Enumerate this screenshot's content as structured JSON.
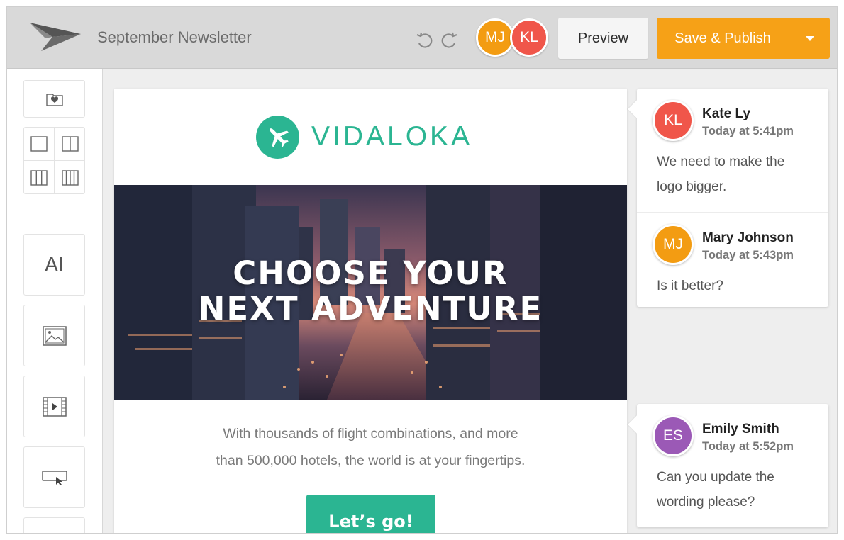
{
  "header": {
    "title": "September Newsletter",
    "collaborators": [
      {
        "initials": "MJ",
        "color": "#f39c12"
      },
      {
        "initials": "KL",
        "color": "#f0564a"
      }
    ],
    "preview_label": "Preview",
    "publish_label": "Save & Publish"
  },
  "sidebar": {
    "text_tool_label": "AI"
  },
  "email": {
    "brand_name": "VIDALOKA",
    "brand_color": "#2bb592",
    "hero_line1": "CHOOSE YOUR",
    "hero_line2": "NEXT ADVENTURE",
    "body_line1": "With thousands of flight combinations, and more",
    "body_line2": "than 500,000 hotels, the world is at your fingertips.",
    "cta_label": "Let’s go!"
  },
  "comments": {
    "thread1": [
      {
        "initials": "KL",
        "color": "#f0564a",
        "name": "Kate Ly",
        "time": "Today at 5:41pm",
        "text": "We need to make the logo bigger."
      },
      {
        "initials": "MJ",
        "color": "#f39c12",
        "name": "Mary Johnson",
        "time": "Today at 5:43pm",
        "text": "Is it better?"
      }
    ],
    "thread2": [
      {
        "initials": "ES",
        "color": "#9b59b6",
        "name": "Emily Smith",
        "time": "Today at 5:52pm",
        "text": "Can you update the wording please?"
      }
    ]
  },
  "colors": {
    "accent": "#f6a117",
    "topbar": "#d9d9d9"
  }
}
